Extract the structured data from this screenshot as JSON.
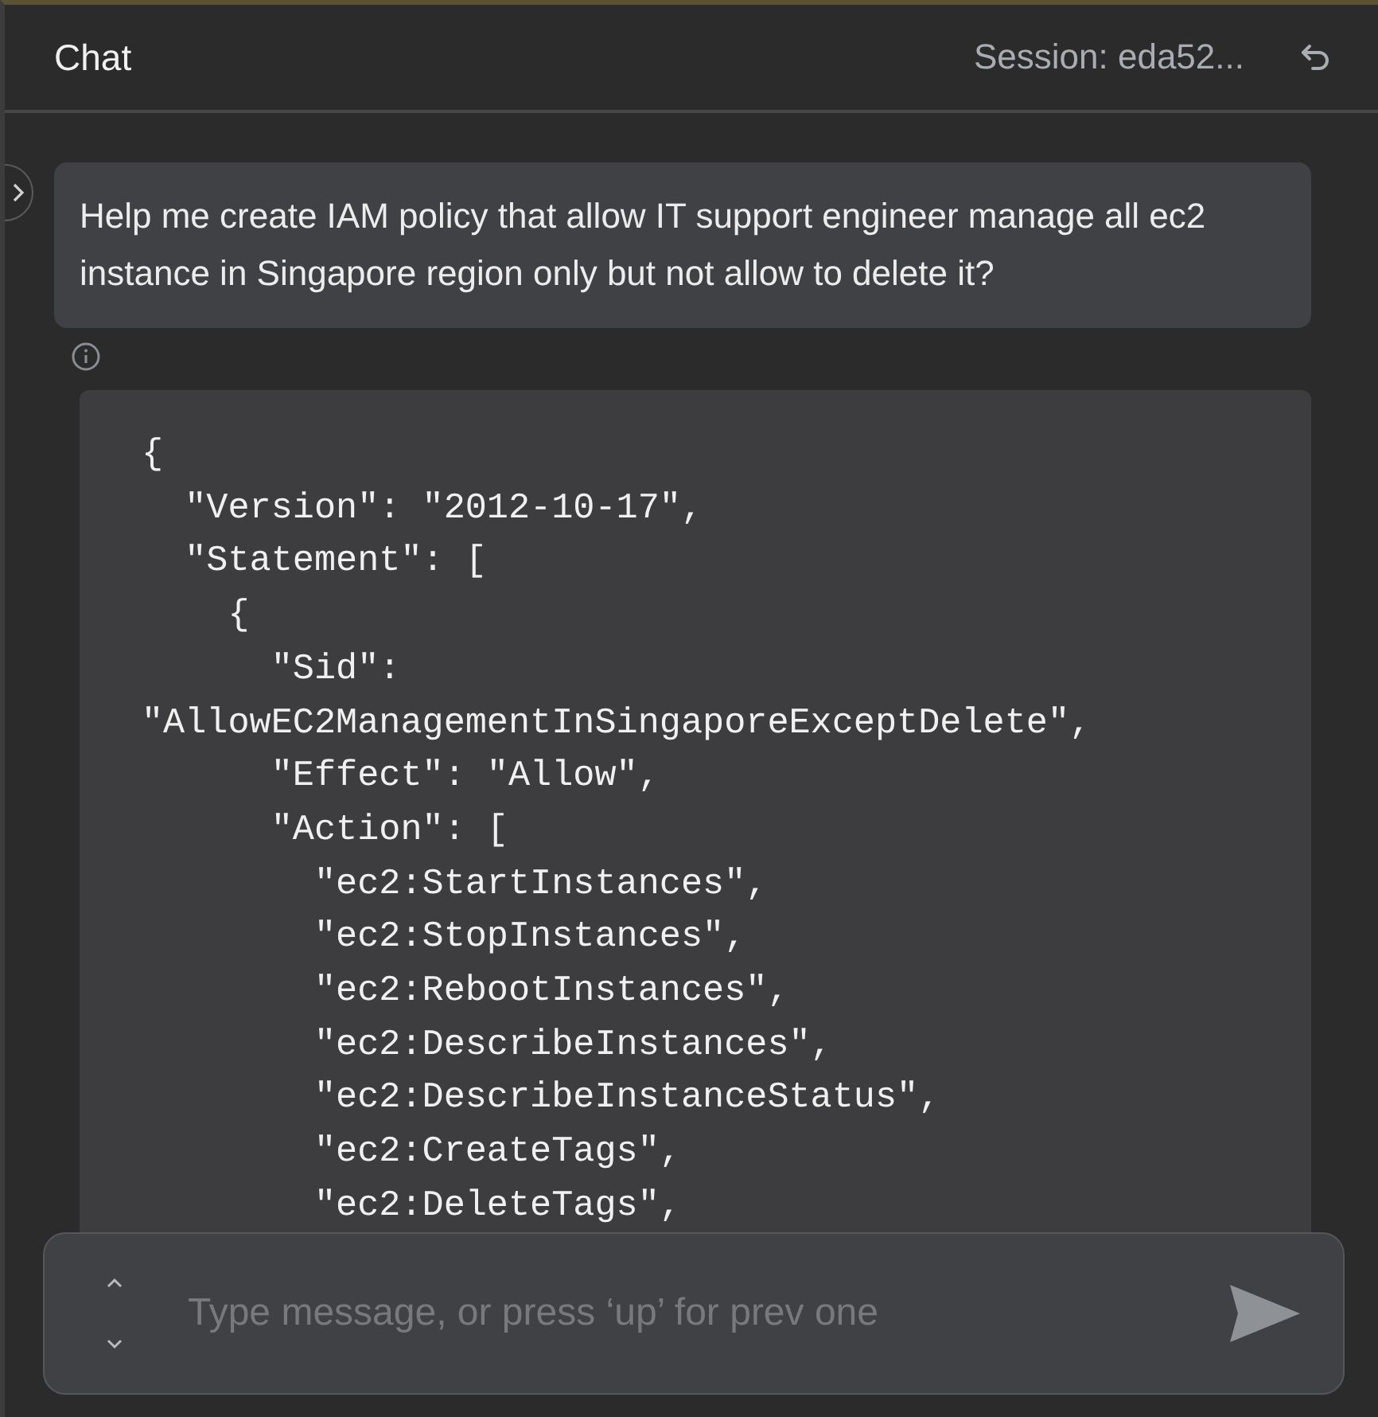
{
  "header": {
    "title": "Chat",
    "session": "Session: eda52..."
  },
  "user_message": "Help me create IAM policy that allow IT support engineer manage all ec2 instance in Singapore region only but not allow to delete it?",
  "code_lines": [
    "{",
    "  \"Version\": \"2012-10-17\",",
    "  \"Statement\": [",
    "    {",
    "      \"Sid\":",
    "\"AllowEC2ManagementInSingaporeExceptDelete\",",
    "      \"Effect\": \"Allow\",",
    "      \"Action\": [",
    "        \"ec2:StartInstances\",",
    "        \"ec2:StopInstances\",",
    "        \"ec2:RebootInstances\",",
    "        \"ec2:DescribeInstances\",",
    "        \"ec2:DescribeInstanceStatus\",",
    "        \"ec2:CreateTags\",",
    "        \"ec2:DeleteTags\","
  ],
  "composer": {
    "placeholder": "Type message, or press ‘up’ for prev one"
  }
}
